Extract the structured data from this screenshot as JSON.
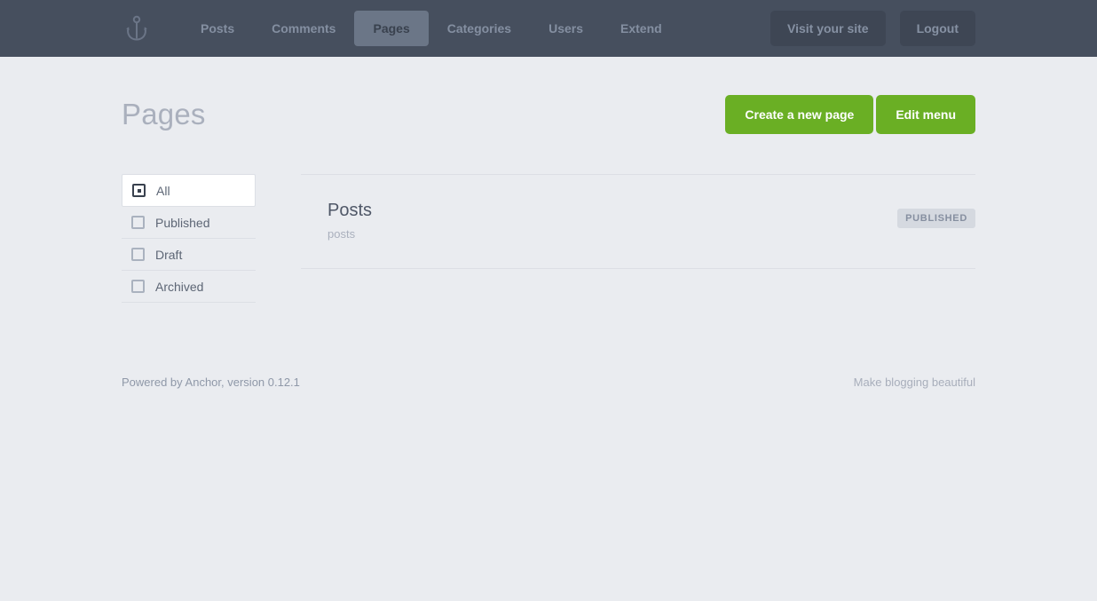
{
  "topbar": {
    "logo_icon": "anchor-icon",
    "nav": [
      {
        "label": "Posts",
        "active": false
      },
      {
        "label": "Comments",
        "active": false
      },
      {
        "label": "Pages",
        "active": true
      },
      {
        "label": "Categories",
        "active": false
      },
      {
        "label": "Users",
        "active": false
      },
      {
        "label": "Extend",
        "active": false
      }
    ],
    "visit_site_label": "Visit your site",
    "logout_label": "Logout"
  },
  "page": {
    "title": "Pages",
    "create_label": "Create a new page",
    "edit_menu_label": "Edit menu"
  },
  "filters": [
    {
      "label": "All",
      "selected": true
    },
    {
      "label": "Published",
      "selected": false
    },
    {
      "label": "Draft",
      "selected": false
    },
    {
      "label": "Archived",
      "selected": false
    }
  ],
  "pages_list": [
    {
      "title": "Posts",
      "slug": "posts",
      "status": "PUBLISHED"
    }
  ],
  "footer": {
    "left": "Powered by Anchor, version 0.12.1",
    "right": "Make blogging beautiful"
  },
  "colors": {
    "topbar_bg": "#464f5e",
    "page_bg": "#eaecf0",
    "accent_green": "#6aaf24",
    "badge_bg": "#d5d9e0",
    "nav_link": "#848fa1",
    "active_tab_bg": "#6b7687"
  }
}
